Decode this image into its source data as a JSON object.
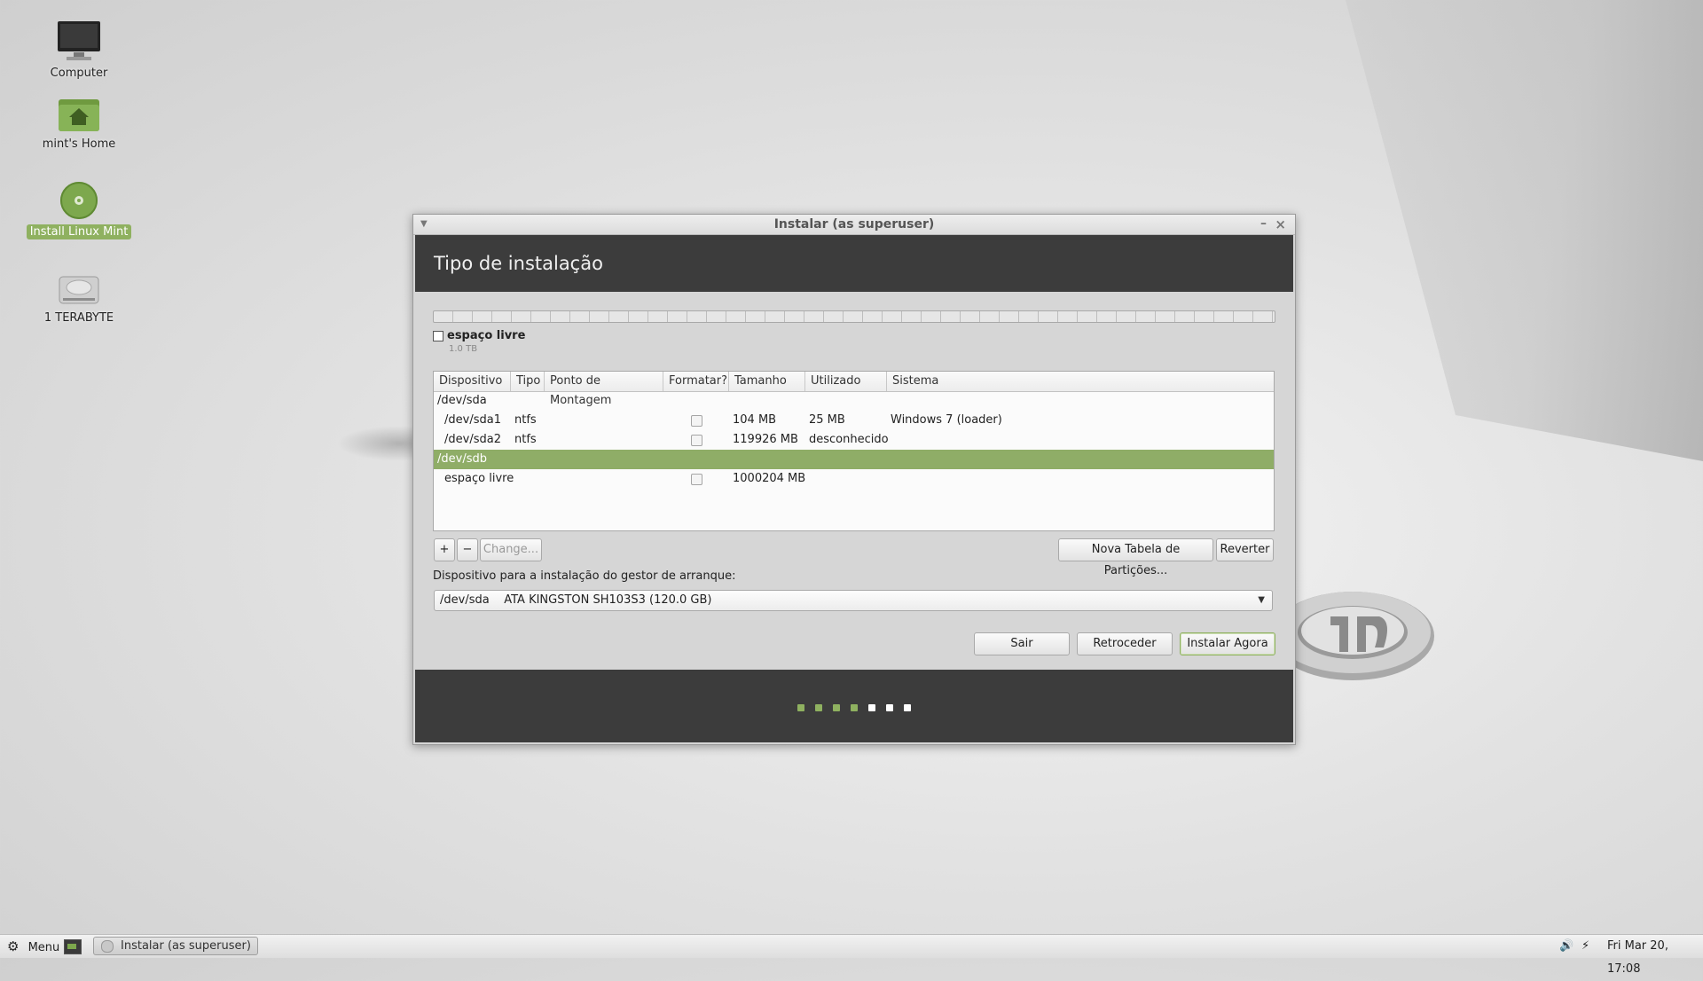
{
  "desktop": {
    "icons": [
      {
        "label": "Computer",
        "icon": "monitor-icon"
      },
      {
        "label": "mint's Home",
        "icon": "home-folder-icon"
      },
      {
        "label": "Install Linux Mint",
        "icon": "disc-icon"
      },
      {
        "label": "1 TERABYTE",
        "icon": "drive-icon"
      }
    ]
  },
  "window": {
    "title": "Instalar (as superuser)",
    "heading": "Tipo de instalação",
    "partition_legend": {
      "name": "espaço livre",
      "size": "1.0 TB"
    },
    "table": {
      "headers": [
        "Dispositivo",
        "Tipo",
        "Ponto de Montagem",
        "Formatar?",
        "Tamanho",
        "Utilizado",
        "Sistema"
      ],
      "rows": [
        {
          "device": "/dev/sda",
          "type": "",
          "mount": "",
          "size": "",
          "used": "",
          "system": ""
        },
        {
          "device": "/dev/sda1",
          "type": "ntfs",
          "mount": "",
          "size": "104 MB",
          "used": "25 MB",
          "system": "Windows 7 (loader)"
        },
        {
          "device": "/dev/sda2",
          "type": "ntfs",
          "mount": "",
          "size": "119926 MB",
          "used": "desconhecido",
          "system": ""
        },
        {
          "device": "/dev/sdb",
          "type": "",
          "mount": "",
          "size": "",
          "used": "",
          "system": ""
        },
        {
          "device": "espaço livre",
          "type": "",
          "mount": "",
          "size": "1000204 MB",
          "used": "",
          "system": ""
        }
      ]
    },
    "buttons": {
      "add": "+",
      "remove": "−",
      "change": "Change...",
      "new_table": "Nova Tabela de Partições...",
      "revert": "Reverter",
      "quit": "Sair",
      "back": "Retroceder",
      "install": "Instalar Agora"
    },
    "bootloader_label": "Dispositivo para a instalação do gestor de arranque:",
    "bootloader_device": "/dev/sda    ATA KINGSTON SH103S3 (120.0 GB)",
    "progress": {
      "total_steps": 7,
      "completed_steps": 4
    }
  },
  "taskbar": {
    "menu_label": "Menu",
    "task_label": "Instalar (as superuser)",
    "clock": "Fri Mar 20, 17:08"
  },
  "colors": {
    "accent": "#8fb160",
    "dark_band": "#3c3c3c"
  }
}
